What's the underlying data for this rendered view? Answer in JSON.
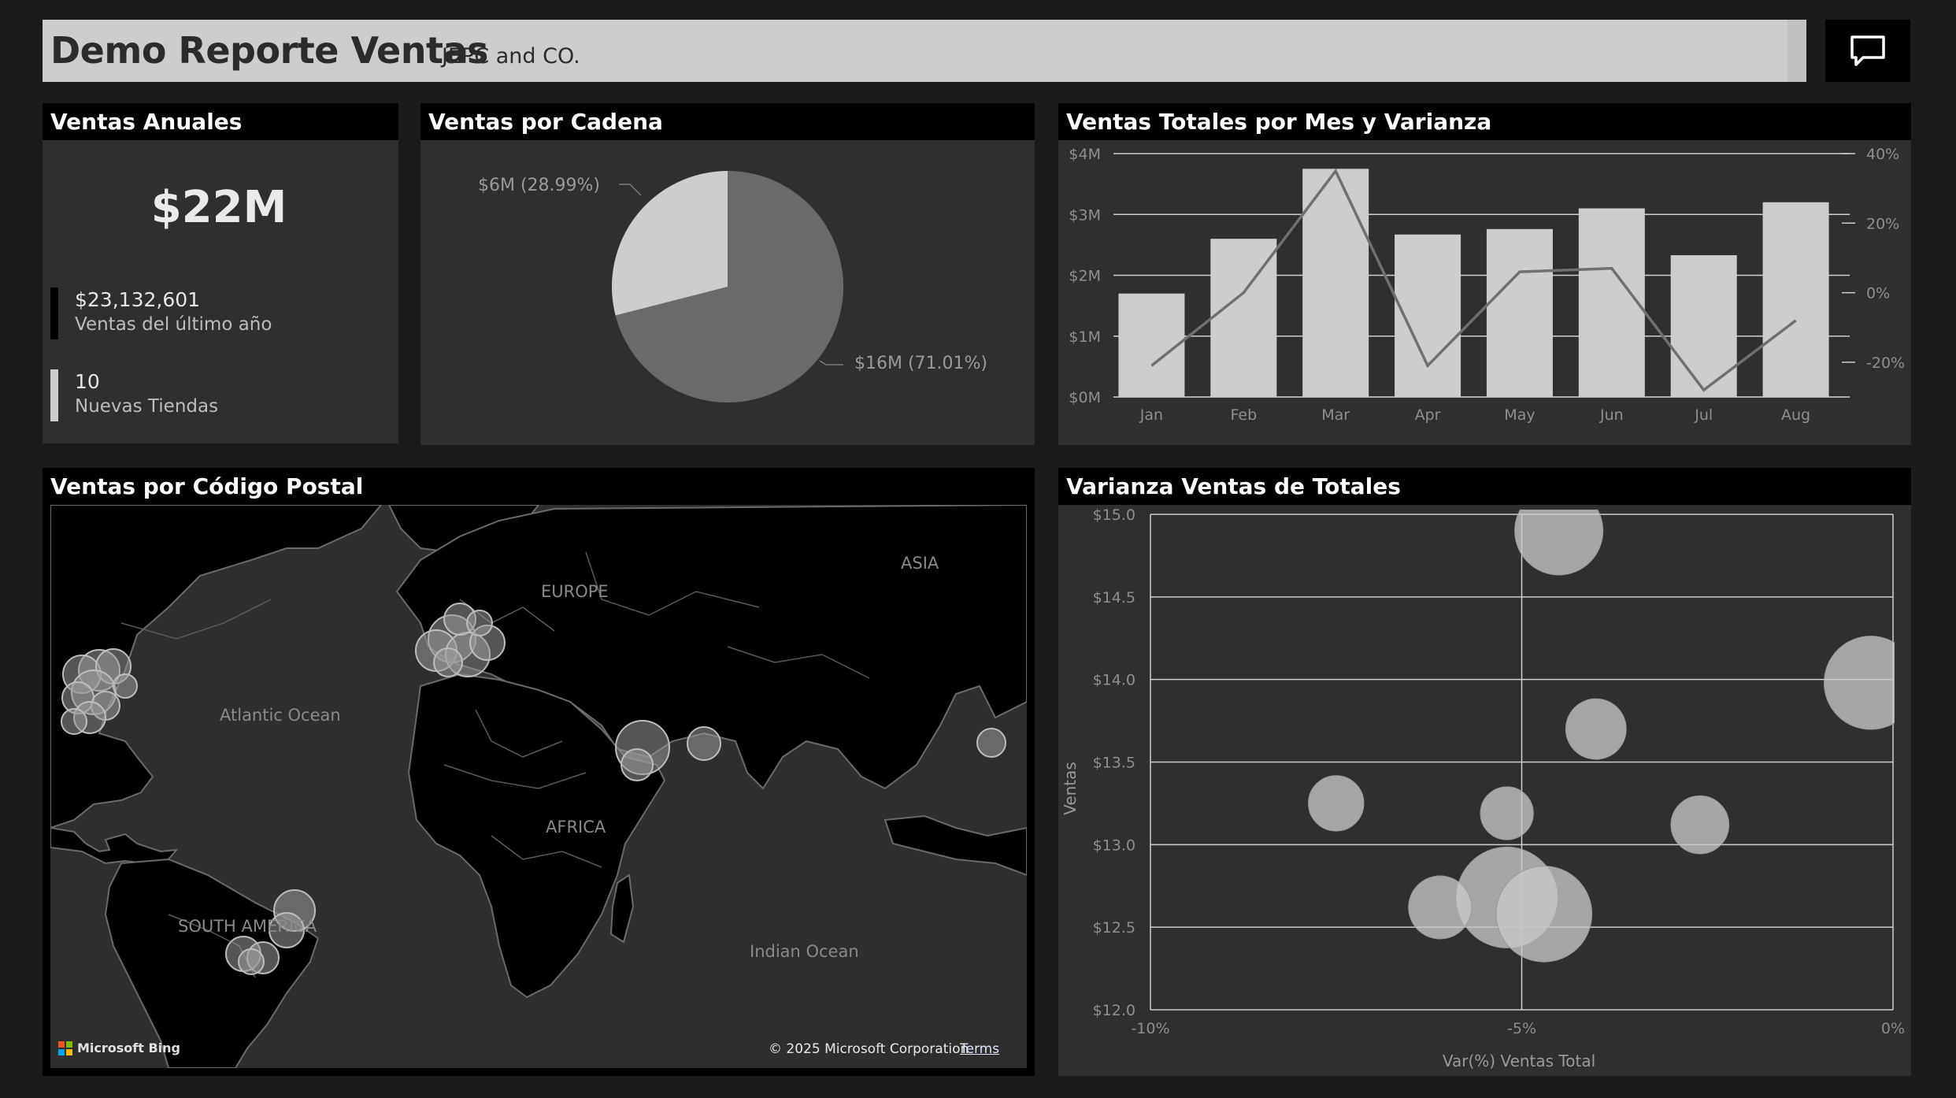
{
  "header": {
    "title": "Demo Reporte Ventas",
    "subtitle": "JEPC and CO.",
    "comment_icon": "comment-icon"
  },
  "kpi": {
    "title": "Ventas Anuales",
    "value": "$22M",
    "items": [
      {
        "value": "$23,132,601",
        "label": "Ventas del último año",
        "color": "#000000"
      },
      {
        "value": "10",
        "label": "Nuevas Tiendas",
        "color": "#cdcdcd"
      }
    ]
  },
  "pie": {
    "title": "Ventas por Cadena",
    "chart_data": {
      "type": "pie",
      "slices": [
        {
          "label": "$6M (28.99%)",
          "value": 28.99,
          "color": "#cdcdcd"
        },
        {
          "label": "$16M (71.01%)",
          "value": 71.01,
          "color": "#6a6a6a"
        }
      ]
    }
  },
  "bars": {
    "title": "Ventas Totales por Mes y Varianza",
    "chart_data": {
      "type": "bar",
      "categories": [
        "Jan",
        "Feb",
        "Mar",
        "Apr",
        "May",
        "Jun",
        "Jul",
        "Aug"
      ],
      "series": [
        {
          "values": [
            1.7,
            2.6,
            3.75,
            2.67,
            2.76,
            3.1,
            2.33,
            3.2
          ]
        },
        {
          "values": [
            -21,
            0,
            35,
            -21,
            6,
            7,
            -28,
            -8
          ]
        }
      ],
      "left_ticks": [
        "$0M",
        "$1M",
        "$2M",
        "$3M",
        "$4M"
      ],
      "ylim": [
        0,
        4
      ],
      "right_ticks": [
        "-20%",
        "0%",
        "20%",
        "40%"
      ],
      "y2lim": [
        -30,
        40
      ],
      "colors": {
        "bar": "#cdcdcd",
        "line": "#707070",
        "grid": "#cfcfcf"
      }
    }
  },
  "map": {
    "title": "Ventas por Código Postal",
    "labels": {
      "europe": "EUROPE",
      "asia": "ASIA",
      "atlantic": "Atlantic Ocean",
      "africa": "AFRICA",
      "south_america": "SOUTH AMERICA",
      "indian": "Indian Ocean"
    },
    "logo": "Microsoft Bing",
    "copyright": "© 2025 Microsoft Corporation",
    "terms": "Terms"
  },
  "bubble": {
    "title": "Varianza Ventas de Totales",
    "chart_data": {
      "type": "scatter",
      "xlabel": "Var(%) Ventas Total",
      "ylabel": "Ventas",
      "xlim": [
        -10,
        0
      ],
      "ylim": [
        12.0,
        15.0
      ],
      "x_ticks": [
        "-10%",
        "-5%",
        "0%"
      ],
      "y_ticks": [
        "$12.0",
        "$12.5",
        "$13.0",
        "$13.5",
        "$14.0",
        "$14.5",
        "$15.0"
      ],
      "points": [
        {
          "x": -4.5,
          "y": 14.9,
          "size": 3.5
        },
        {
          "x": -0.3,
          "y": 13.98,
          "size": 3.7
        },
        {
          "x": -4.0,
          "y": 13.7,
          "size": 2.4
        },
        {
          "x": -7.5,
          "y": 13.25,
          "size": 2.2
        },
        {
          "x": -5.2,
          "y": 13.19,
          "size": 2.1
        },
        {
          "x": -2.6,
          "y": 13.12,
          "size": 2.3
        },
        {
          "x": -5.2,
          "y": 12.68,
          "size": 4.0
        },
        {
          "x": -6.1,
          "y": 12.62,
          "size": 2.5
        },
        {
          "x": -4.7,
          "y": 12.58,
          "size": 3.8
        }
      ]
    }
  }
}
